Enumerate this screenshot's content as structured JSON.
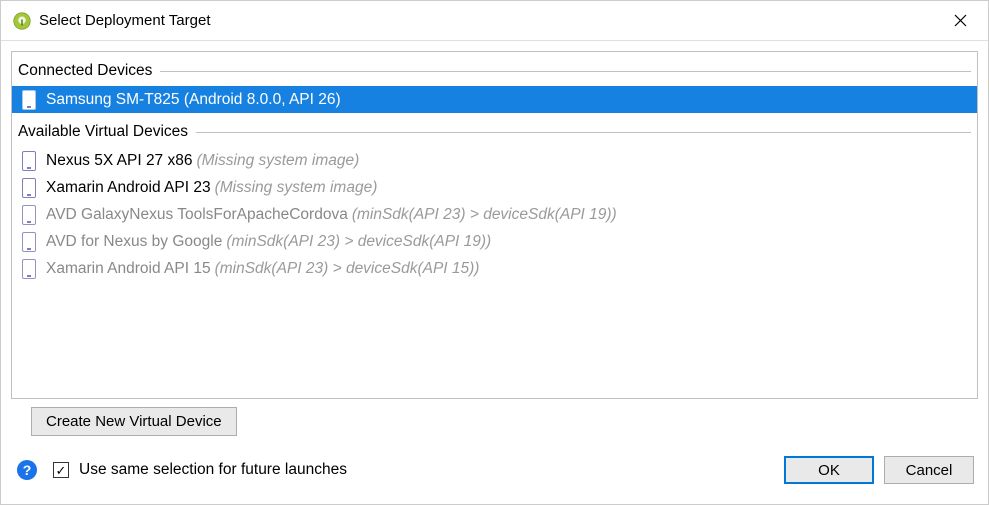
{
  "window": {
    "title": "Select Deployment Target"
  },
  "sections": {
    "connected_label": "Connected Devices",
    "available_label": "Available Virtual Devices"
  },
  "connected_devices": [
    {
      "name": "Samsung SM-T825 (Android 8.0.0, API 26)",
      "note": "",
      "selected": true,
      "greyed": false
    }
  ],
  "virtual_devices": [
    {
      "name": "Nexus 5X API 27 x86",
      "note": "(Missing system image)",
      "selected": false,
      "greyed": false
    },
    {
      "name": "Xamarin Android API 23",
      "note": "(Missing system image)",
      "selected": false,
      "greyed": false
    },
    {
      "name": "AVD GalaxyNexus ToolsForApacheCordova",
      "note": "(minSdk(API 23) > deviceSdk(API 19))",
      "selected": false,
      "greyed": true
    },
    {
      "name": "AVD for Nexus by Google",
      "note": "(minSdk(API 23) > deviceSdk(API 19))",
      "selected": false,
      "greyed": true
    },
    {
      "name": "Xamarin Android API 15",
      "note": "(minSdk(API 23) > deviceSdk(API 15))",
      "selected": false,
      "greyed": true
    }
  ],
  "buttons": {
    "create_new": "Create New Virtual Device",
    "ok": "OK",
    "cancel": "Cancel"
  },
  "checkbox": {
    "label": "Use same selection for future launches",
    "checked": true
  }
}
